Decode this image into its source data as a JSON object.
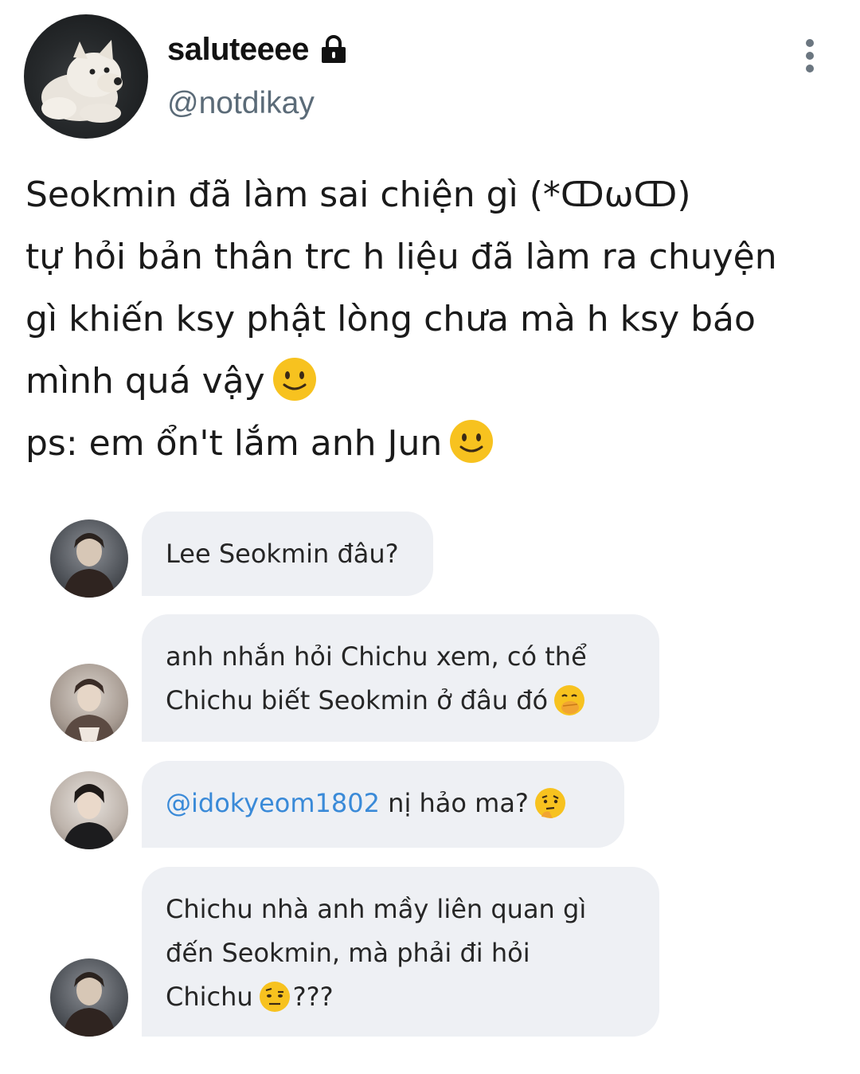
{
  "user": {
    "display_name": "saluteeee",
    "handle": "@notdikay",
    "avatar_icon": "dog-avatar",
    "protected_icon": "lock-icon"
  },
  "menu_icon": "more-vertical-icon",
  "tweet": {
    "lines": [
      "Seokmin đã làm sai chiện gì (*ↀωↀ)",
      "tự hỏi bản thân trc h liệu đã làm ra chuyện",
      "gì khiến ksy phật lòng chưa mà h ksy báo",
      "mình quá vậy",
      "ps: em ổn't lắm anh Jun"
    ]
  },
  "chat": {
    "messages": [
      {
        "lines": [
          "Lee Seokmin đâu?"
        ]
      },
      {
        "lines": [
          "anh nhắn hỏi Chichu xem, có thể",
          "Chichu biết Seokmin ở đâu đó"
        ],
        "emoji": "hand-over-mouth-emoji"
      },
      {
        "mention": "@idokyeom1802",
        "text": " nị hảo ma?",
        "emoji": "thinking-emoji"
      },
      {
        "lines": [
          "Chichu nhà anh mầy liên quan gì",
          "đến Seokmin, mà phải đi hỏi",
          "Chichu",
          "???"
        ],
        "emoji": "raised-eyebrow-emoji"
      }
    ]
  },
  "colors": {
    "bubble_bg": "#eef0f4",
    "mention": "#3a8ad8",
    "handle": "#5b6b78",
    "emoji_yellow": "#f7c21f"
  }
}
